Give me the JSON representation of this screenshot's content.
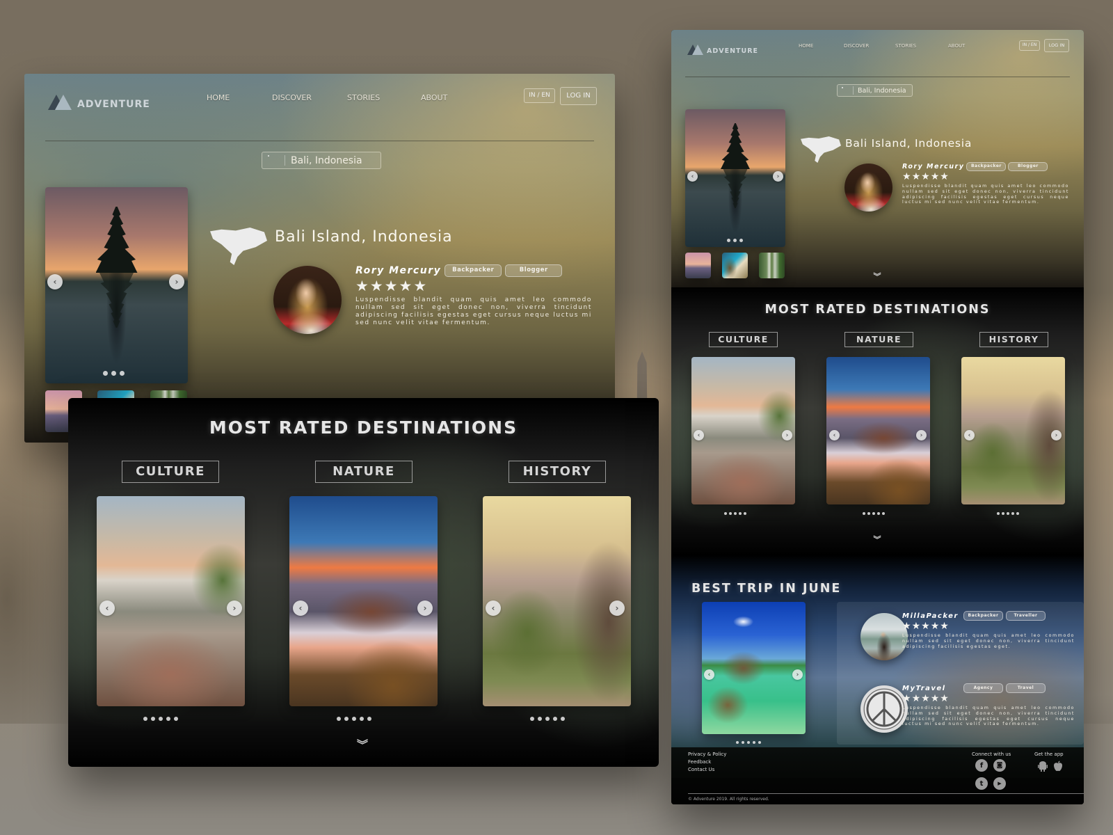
{
  "brand": {
    "name": "ADVENTURE"
  },
  "nav": {
    "items": [
      "HOME",
      "DISCOVER",
      "STORIES",
      "ABOUT"
    ],
    "language_toggle": "IN / EN",
    "login_label": "LOG IN"
  },
  "search": {
    "icon": "search-icon",
    "value": "Bali, Indonesia"
  },
  "hero": {
    "location_title": "Bali Island, Indonesia",
    "location_icon": "bali-map-icon",
    "carousel": {
      "dot_count": 3,
      "prev_icon": "chevron-left-icon",
      "next_icon": "chevron-right-icon"
    },
    "thumbnails": [
      "Mount Batur sunrise",
      "Kelingking Beach",
      "Tropical waterfall"
    ],
    "author": {
      "name": "Rory Mercury",
      "tags": [
        "Backpacker",
        "Blogger"
      ],
      "rating": 5,
      "rating_max": 5,
      "bio": "Luspendisse blandit quam quis amet leo commodo nullam sed sit eget donec non, viverra tincidunt adipiscing facilisis egestas eget cursus neque luctus mi sed nunc velit vitae fermentum."
    },
    "scroll_icon": "double-chevron-down-icon"
  },
  "most_rated": {
    "title": "MOST RATED DESTINATIONS",
    "categories": [
      {
        "label": "CULTURE",
        "image": "Kecak dance at Uluwatu",
        "dot_count": 5
      },
      {
        "label": "NATURE",
        "image": "Mount Bromo",
        "dot_count": 5
      },
      {
        "label": "HISTORY",
        "image": "Ancient Hindu temple",
        "dot_count": 5
      }
    ],
    "scroll_icon": "double-chevron-down-icon"
  },
  "best_trip": {
    "title": "BEST TRIP IN JUNE",
    "carousel": {
      "image": "Granite boulders lagoon",
      "dot_count": 5
    },
    "reviews": [
      {
        "name": "MillaPacker",
        "tags": [
          "Backpacker",
          "Traveller"
        ],
        "rating": 5,
        "rating_max": 5,
        "bio": "Luspendisse blandit quam quis amet leo commodo nullam sed sit eget donec non, viverra tincidunt adipiscing facilisis egestas eget."
      },
      {
        "name": "MyTravel",
        "tags": [
          "Agency",
          "Travel"
        ],
        "rating": 5,
        "rating_max": 5,
        "bio": "Luspendisse blandit quam quis amet leo commodo nullam sed sit eget donec non, viverra tincidunt adipiscing facilisis egestas eget cursus neque luctus mi sed nunc velit vitae fermentum."
      }
    ]
  },
  "footer": {
    "links": [
      "Privacy & Policy",
      "Feedback",
      "Contact Us"
    ],
    "connect_label": "Connect with us",
    "social": [
      {
        "name": "facebook",
        "glyph": "f"
      },
      {
        "name": "instagram",
        "glyph": "◙"
      },
      {
        "name": "twitter",
        "glyph": "t"
      },
      {
        "name": "youtube",
        "glyph": "▶"
      }
    ],
    "app_label": "Get the app",
    "apps": [
      "android",
      "apple"
    ],
    "copyright": "© Adventure 2019. All rights reserved."
  }
}
